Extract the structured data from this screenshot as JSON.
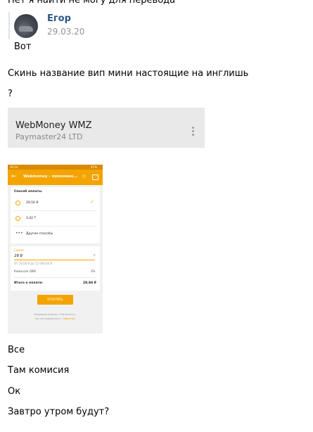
{
  "top_text": "Нет я найти не могу для перевода",
  "quote": {
    "author": "Егор",
    "date": "29.03.20",
    "text": "Вот"
  },
  "messages": [
    "Скинь название вип мини настоящие на инглишь",
    "?",
    "Все",
    "Там комисия",
    "Ок",
    "Завтро утром будут?"
  ],
  "link_card": {
    "title": "WebMoney WMZ",
    "subtitle": "Paymaster24 LTD"
  },
  "phone": {
    "status_left": "20:14",
    "status_right": "41%",
    "app_title": "Webmoney – пополнен...",
    "payment_header": "Способ оплаты",
    "options": [
      "29,50 ₽",
      "3,42 Т",
      "Другие способы"
    ],
    "amount_label": "Сумма",
    "amount_value": "28 ₽",
    "amount_hint": "От 10,00 ₽ до 15 000,00 ₽",
    "commission_label": "Комиссия QIWI",
    "commission_value": "3%",
    "total_label": "Итого к оплате:",
    "total_value": "28,84 ₽",
    "pay_button": "ОПЛАТИТЬ",
    "footer_line1": "Нажимая кнопку «Оплатить»,",
    "footer_line2_a": "вы соглашаетесь с ",
    "footer_line2_b": "офертой",
    "accent_color": "#f3a400"
  }
}
